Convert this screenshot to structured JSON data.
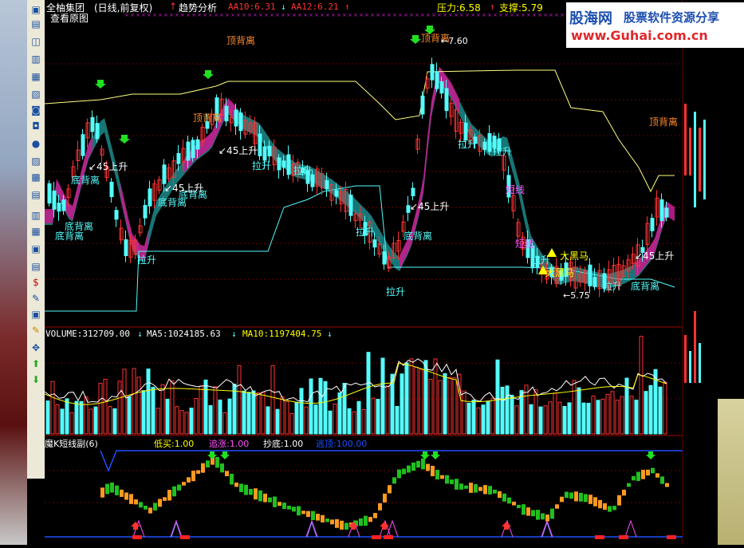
{
  "main_panel": {
    "stock_name": "全柚集团",
    "period": "(日线,前复权)",
    "indicator_name": "趋势分析",
    "aa10": "AA10:6.31",
    "aa12": "AA12:6.21",
    "pressure": "压力:6.58",
    "support": "支撑:5.79",
    "view_original": "查看原图",
    "high_label": "7.60",
    "low_label": "5.75",
    "annotations": {
      "top_divergence": "顶背离",
      "bottom_divergence": "底背离",
      "rise_45": "45上升",
      "pull_up": "拉升",
      "big_horse": "大黑马",
      "short_line": "短线",
      "pull_up_alt": "拉升"
    }
  },
  "volume_panel": {
    "volume": "VOLUME:312709.00",
    "ma5": "MA5:1024185.63",
    "ma10": "MA10:1197404.75"
  },
  "sub_panel": {
    "name": "魔K短线副(6)",
    "low_buy": "低买:1.00",
    "chase": "追涨:1.00",
    "bottom": "抄底:1.00",
    "escape": "逃顶:100.00"
  },
  "logo": {
    "brand": "股海网",
    "slogan": "股票软件资源分享",
    "url": "www.Guhai.com.cn"
  },
  "colors": {
    "up": "#ff3232",
    "down": "#54fcfc",
    "ma_line": "#ffff00",
    "band_magenta": "#c01d8c",
    "band_teal": "#1c8a8a"
  }
}
